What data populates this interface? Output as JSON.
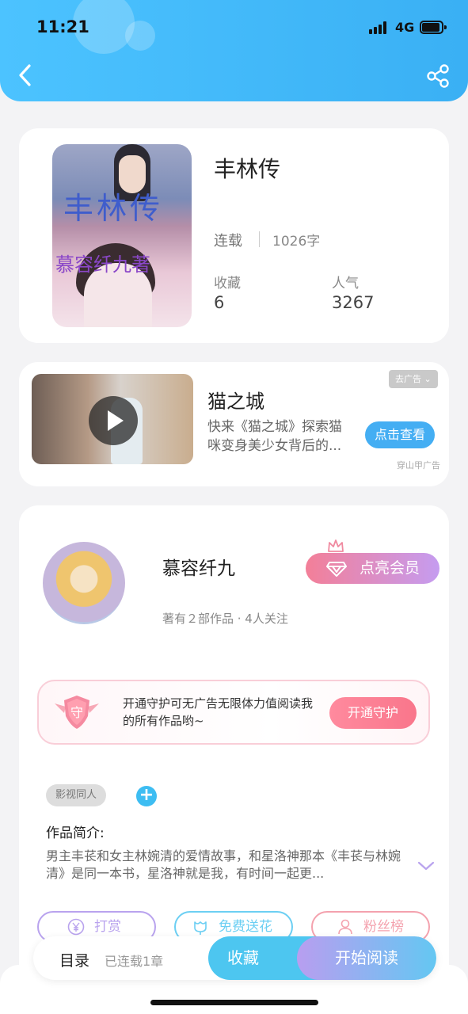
{
  "status_bar": {
    "time": "11:21",
    "network": "4G"
  },
  "nav": {
    "back_icon": "chevron-left-icon",
    "share_icon": "share-icon"
  },
  "book": {
    "title": "丰林传",
    "cover_title": "丰林传",
    "cover_subtitle": "慕容纤九著",
    "status": "连载",
    "word_count": "1026字",
    "favorites_label": "收藏",
    "favorites_value": "6",
    "popularity_label": "人气",
    "popularity_value": "3267"
  },
  "ad": {
    "title": "猫之城",
    "description": "快来《猫之城》探索猫咪变身美少女背后的...",
    "close_label": "去广告 ⌄",
    "cta_label": "点击查看",
    "source": "穿山甲广告"
  },
  "author": {
    "name": "慕容纤九",
    "meta": "著有２部作品 · 4人关注",
    "vip_label": "点亮会员"
  },
  "guard": {
    "text": "开通守护可无广告无限体力值阅读我的所有作品哟~",
    "button_label": "开通守护",
    "badge_char": "守"
  },
  "intro": {
    "tag": "影视同人",
    "add_symbol": "+",
    "label": "作品简介:",
    "text": "男主丰苌和女主林婉清的爱情故事，和星洛神那本《丰苌与林婉清》是同一本书，星洛神就是我，有时间一起更..."
  },
  "actions": [
    {
      "label": "打赏",
      "icon": "yen-icon",
      "color": "#b9a3ee"
    },
    {
      "label": "免费送花",
      "icon": "flower-icon",
      "color": "#6ccff3"
    },
    {
      "label": "粉丝榜",
      "icon": "user-icon",
      "color": "#f4a2ae"
    }
  ],
  "bottom_bar": {
    "toc_label": "目录",
    "toc_sub": "已连载1章",
    "favorite_label": "收藏",
    "read_label": "开始阅读"
  }
}
